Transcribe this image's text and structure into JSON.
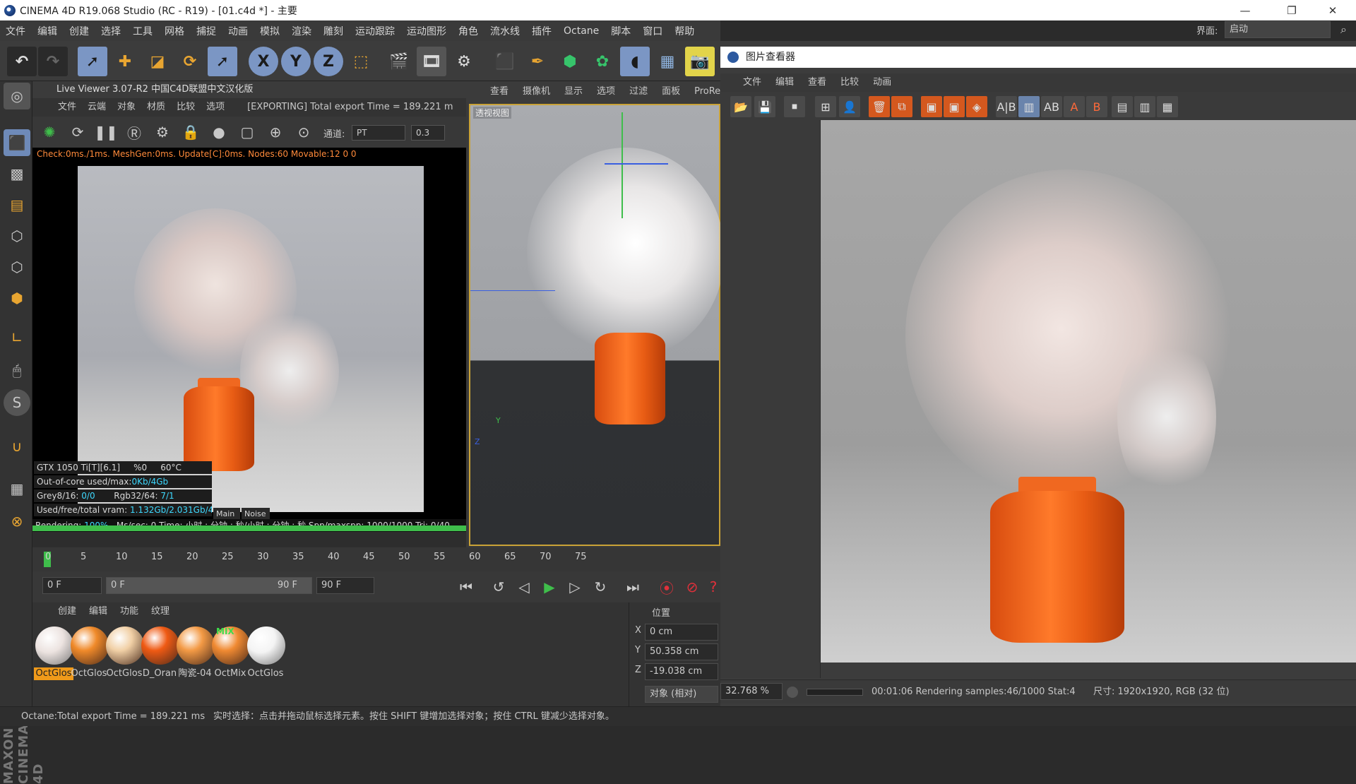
{
  "window": {
    "title": "CINEMA 4D R19.068 Studio (RC - R19) - [01.c4d *] - 主要",
    "layout_label": "界面:",
    "layout_value": "启动"
  },
  "menubar": [
    "文件",
    "编辑",
    "创建",
    "选择",
    "工具",
    "网格",
    "捕捉",
    "动画",
    "模拟",
    "渲染",
    "雕刻",
    "运动跟踪",
    "运动图形",
    "角色",
    "流水线",
    "插件",
    "Octane",
    "脚本",
    "窗口",
    "帮助"
  ],
  "live_viewer": {
    "title": "Live Viewer 3.07-R2 中国C4D联盟中文汉化版",
    "menu": [
      "文件",
      "云端",
      "对象",
      "材质",
      "比较",
      "选项"
    ],
    "export_text": "[EXPORTING] Total export Time = 189.221 m",
    "channel_label": "通道:",
    "channel_value": "PT",
    "channel_num": "0.3",
    "stat_line": "Check:0ms./1ms. MeshGen:0ms. Update[C]:0ms. Nodes:60 Movable:12  0 0",
    "gpu": "GTX 1050 Ti[T][6.1]",
    "gpu_pct": "%0",
    "gpu_temp": "60°C",
    "outofcore_label": "Out-of-core used/max:",
    "outofcore_val": "0Kb/4Gb",
    "grey_label": "Grey8/16:",
    "grey_val": "0/0",
    "rgb_label": "Rgb32/64:",
    "rgb_val": "7/1",
    "vram_label": "Used/free/total vram:",
    "vram_val": "1.132Gb/2.031Gb/4G",
    "tab_main": "Main",
    "tab_noise": "Noise",
    "render_line_label": "Rendering:",
    "render_pct": "100%",
    "render_rest": "Ms/sec: 0   Time: 小时 : 分钟 : 秒/小时 : 分钟 : 秒   Spp/maxspp: 1000/1000  Tri: 0/40",
    "progress": 1.0
  },
  "viewport": {
    "menu": [
      "查看",
      "摄像机",
      "显示",
      "选项",
      "过滤",
      "面板",
      "ProRen"
    ],
    "label": "透视视图"
  },
  "timeline": {
    "ticks": [
      "0",
      "5",
      "10",
      "15",
      "20",
      "25",
      "30",
      "35",
      "40",
      "45",
      "50",
      "55",
      "60",
      "65",
      "70",
      "75"
    ],
    "start_field": "0 F",
    "range_start": "0 F",
    "range_end": "90 F",
    "end_field": "90 F"
  },
  "materials": {
    "menu": [
      "创建",
      "编辑",
      "功能",
      "纹理"
    ],
    "items": [
      {
        "label": "OctGlos",
        "color": "#ece3e0"
      },
      {
        "label": "OctGlos",
        "color": "#f08a2a"
      },
      {
        "label": "OctGlos",
        "color": "#f1d0a6"
      },
      {
        "label": "D_Oran",
        "color": "#ef5a14"
      },
      {
        "label": "陶瓷-04",
        "color": "#f39a45"
      },
      {
        "label": "OctMix",
        "color": "#f08a32"
      },
      {
        "label": "OctGlos",
        "color": "#f4f4f4"
      }
    ],
    "mix_badge": "MIX"
  },
  "coords": {
    "title": "位置",
    "x_label": "X",
    "x_val": "0 cm",
    "y_label": "Y",
    "y_val": "50.358 cm",
    "z_label": "Z",
    "z_val": "-19.038 cm",
    "mode": "对象 (相对)"
  },
  "picture_viewer": {
    "title": "图片查看器",
    "menu": [
      "文件",
      "编辑",
      "查看",
      "比较",
      "动画"
    ],
    "zoom": "32.768 %",
    "render_status": "00:01:06 Rendering samples:46/1000 Stat:4",
    "size_info": "尺寸: 1920x1920, RGB (32 位)"
  },
  "statusbar": {
    "left": "Octane:Total export Time = 189.221 ms",
    "right": "实时选择：点击并拖动鼠标选择元素。按住 SHIFT 键增加选择对象；按住 CTRL 键减少选择对象。"
  },
  "brand": "MAXON CINEMA 4D"
}
